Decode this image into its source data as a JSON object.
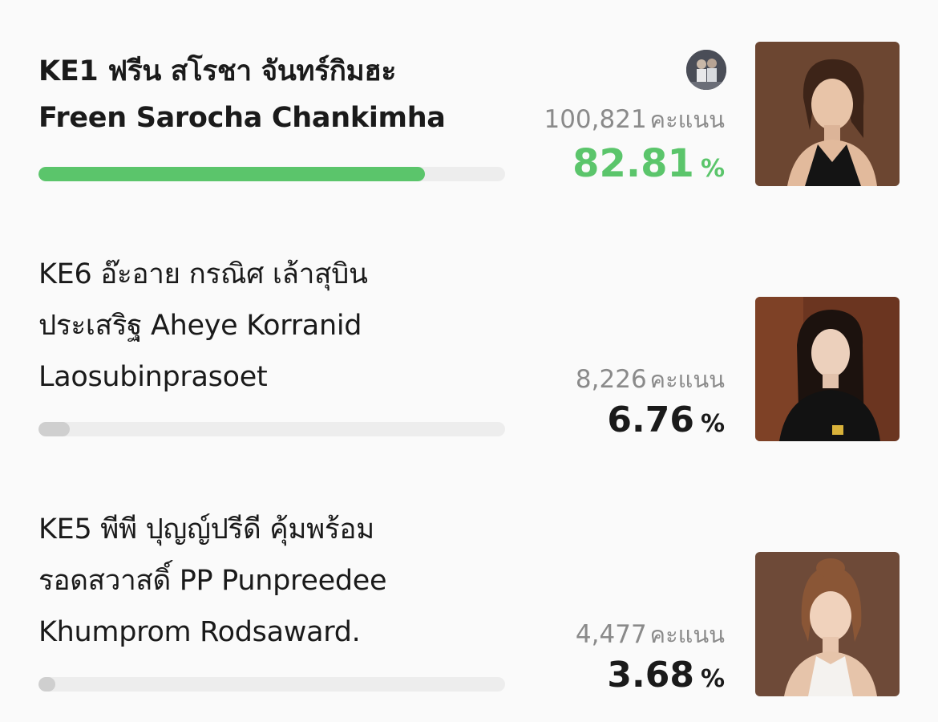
{
  "candidates": [
    {
      "name": "KE1 ฟรีน สโรชา จันทร์กิมฮะ\nFreen Sarocha Chankimha",
      "votes": "100,821",
      "votes_unit": "คะแนน",
      "percent": "82.81",
      "percent_sign": "%",
      "share": 0.8281,
      "leader": true,
      "photo_icon": "portrait-photo"
    },
    {
      "name": "KE6 อ๊ะอาย กรณิศ เล้าสุบิน\nประเสริฐ Aheye Korranid\nLaosubinprasoet",
      "votes": "8,226",
      "votes_unit": "คะแนน",
      "percent": "6.76",
      "percent_sign": "%",
      "share": 0.0676,
      "leader": false,
      "photo_icon": "portrait-photo"
    },
    {
      "name": "KE5 พีพี ปุญญ์ปรีดี คุ้มพร้อม\nรอดสวาสดิ์ PP Punpreedee\nKhumprom Rodsaward.",
      "votes": "4,477",
      "votes_unit": "คะแนน",
      "percent": "3.68",
      "percent_sign": "%",
      "share": 0.0368,
      "leader": false,
      "photo_icon": "portrait-photo"
    }
  ],
  "colors": {
    "leader_accent": "#5bc56b",
    "bar_track": "#ededed",
    "bar_fill": "#cfcfcf"
  },
  "voter_avatar_icon": "user-avatar-icon"
}
